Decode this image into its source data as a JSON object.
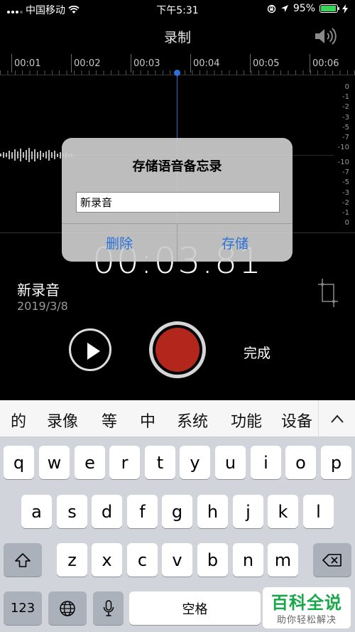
{
  "status_bar": {
    "carrier": "中国移动",
    "time": "下午5:31",
    "battery": "95%",
    "battery_level": 0.95
  },
  "header": {
    "title": "录制"
  },
  "timeline": {
    "labels": [
      "00:01",
      "00:02",
      "00:03",
      "00:04",
      "00:05",
      "00:06"
    ],
    "db_scale": [
      "0",
      "-1",
      "-2",
      "-3",
      "-5",
      "-7",
      "-10",
      "-10",
      "-7",
      "-5",
      "-3",
      "-2",
      "-1",
      "0"
    ]
  },
  "recording": {
    "elapsed": "00:03.81",
    "name": "新录音",
    "date": "2019/3/8",
    "done_label": "完成"
  },
  "dialog": {
    "title": "存储语音备忘录",
    "input_value": "新录音",
    "delete_label": "删除",
    "save_label": "存储"
  },
  "candidates": [
    "的",
    "录像",
    "等",
    "中",
    "系统",
    "功能",
    "设备"
  ],
  "keyboard": {
    "row1": [
      "q",
      "w",
      "e",
      "r",
      "t",
      "y",
      "u",
      "i",
      "o",
      "p"
    ],
    "row2": [
      "a",
      "s",
      "d",
      "f",
      "g",
      "h",
      "j",
      "k",
      "l"
    ],
    "row3": [
      "z",
      "x",
      "c",
      "v",
      "b",
      "n",
      "m"
    ],
    "numbers_label": "123",
    "space_label": "空格"
  },
  "watermark": {
    "title": "百科全说",
    "subtitle": "助你轻松解决"
  },
  "colors": {
    "accent": "#2a72d8",
    "record": "#b3261c",
    "playhead": "#2d6fd6",
    "watermark": "#18a84a"
  }
}
